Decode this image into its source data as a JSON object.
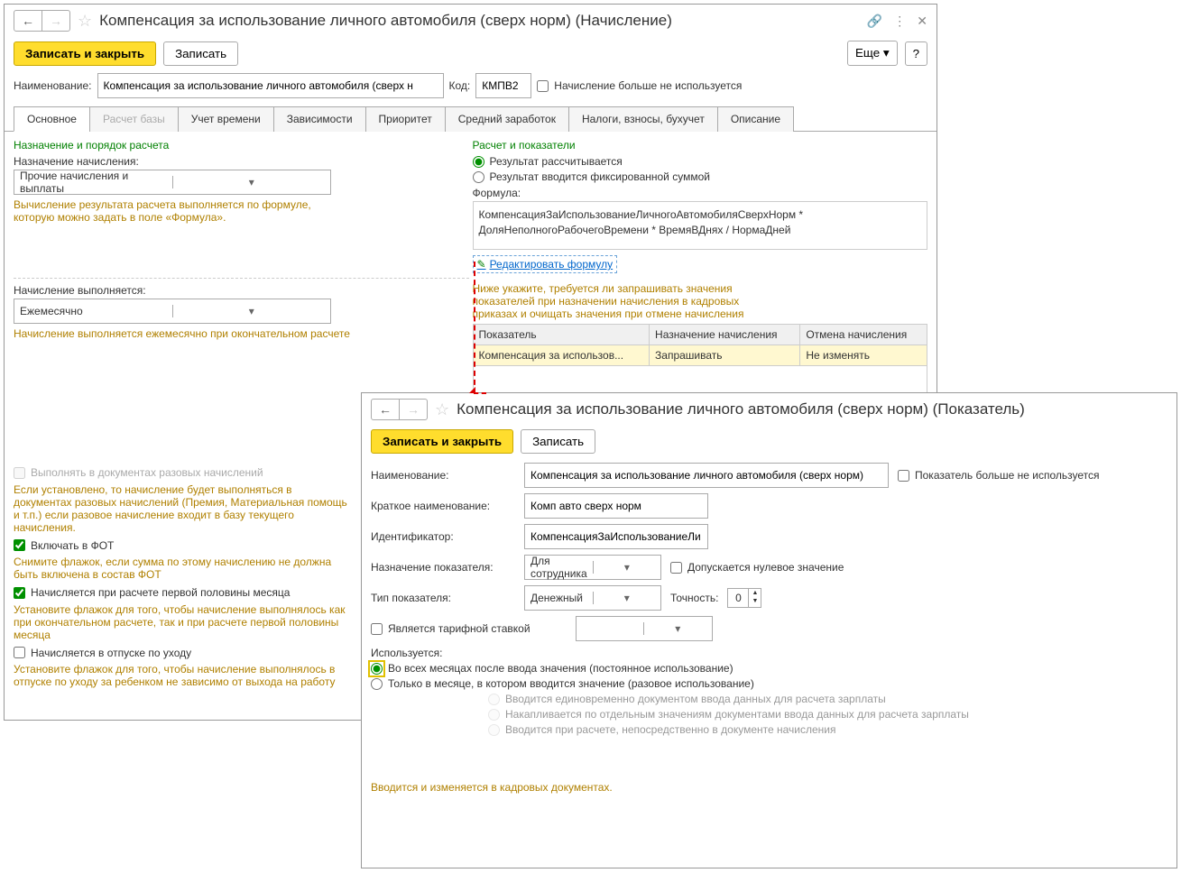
{
  "w1": {
    "title": "Компенсация за использование личного автомобиля (сверх норм) (Начисление)",
    "save_close": "Записать и закрыть",
    "save": "Записать",
    "more": "Еще",
    "name_label": "Наименование:",
    "name_value": "Компенсация за использование личного автомобиля (сверх н",
    "code_label": "Код:",
    "code_value": "КМПВ2",
    "not_used": "Начисление больше не используется",
    "tabs": [
      "Основное",
      "Расчет базы",
      "Учет времени",
      "Зависимости",
      "Приоритет",
      "Средний заработок",
      "Налоги, взносы, бухучет",
      "Описание"
    ],
    "left": {
      "h": "Назначение и порядок расчета",
      "purpose_label": "Назначение начисления:",
      "purpose_value": "Прочие начисления и выплаты",
      "hint1": "Вычисление результата расчета выполняется по формуле, которую можно задать в поле «Формула».",
      "exec_label": "Начисление выполняется:",
      "exec_value": "Ежемесячно",
      "hint2": "Начисление выполняется ежемесячно при окончательном расчете",
      "cb1": "Выполнять в документах разовых начислений",
      "cb1_hint": "Если установлено, то начисление будет выполняться в документах разовых начислений (Премия, Материальная помощь и т.п.) если разовое начисление входит в базу текущего начисления.",
      "cb2": "Включать в ФОТ",
      "cb2_hint": "Снимите флажок, если сумма по этому начислению не должна быть включена в состав ФОТ",
      "cb3": "Начисляется при расчете первой половины месяца",
      "cb3_hint": "Установите флажок для того, чтобы начисление выполнялось как при окончательном расчете, так и при расчете первой половины месяца",
      "cb4": "Начисляется в отпуске по уходу",
      "cb4_hint": "Установите флажок для того, чтобы начисление выполнялось в отпуске по уходу за ребенком не зависимо от выхода на работу"
    },
    "right": {
      "h": "Расчет и показатели",
      "r1": "Результат рассчитывается",
      "r2": "Результат вводится фиксированной суммой",
      "formula_label": "Формула:",
      "formula": "КомпенсацияЗаИспользованиеЛичногоАвтомобиляСверхНорм * ДоляНеполногоРабочегоВремени  * ВремяВДнях / НормаДней",
      "edit": "Редактировать формулу",
      "hint": "Ниже укажите, требуется ли запрашивать значения показателей при назначении начисления в кадровых приказах и очищать значения при отмене начисления",
      "th": [
        "Показатель",
        "Назначение начисления",
        "Отмена начисления"
      ],
      "row": [
        "Компенсация за использов...",
        "Запрашивать",
        "Не изменять"
      ]
    }
  },
  "w2": {
    "title": "Компенсация за использование личного автомобиля (сверх норм) (Показатель)",
    "save_close": "Записать и закрыть",
    "save": "Записать",
    "name_label": "Наименование:",
    "name_value": "Компенсация за использование личного автомобиля (сверх норм)",
    "not_used": "Показатель больше не используется",
    "short_label": "Краткое наименование:",
    "short_value": "Комп авто сверх норм",
    "id_label": "Идентификатор:",
    "id_value": "КомпенсацияЗаИспользованиеЛи",
    "purpose_label": "Назначение показателя:",
    "purpose_value": "Для сотрудника",
    "allow_zero": "Допускается нулевое значение",
    "type_label": "Тип показателя:",
    "type_value": "Денежный",
    "precision_label": "Точность:",
    "precision_value": "0",
    "is_rate": "Является тарифной ставкой",
    "used_label": "Используется:",
    "u1": "Во всех месяцах после ввода значения (постоянное использование)",
    "u2": "Только в месяце, в котором вводится значение (разовое использование)",
    "s1": "Вводится единовременно документом ввода данных для расчета зарплаты",
    "s2": "Накапливается по отдельным значениям документами ввода данных для расчета зарплаты",
    "s3": "Вводится при расчете, непосредственно в документе начисления",
    "footer": "Вводится и изменяется в кадровых документах."
  }
}
